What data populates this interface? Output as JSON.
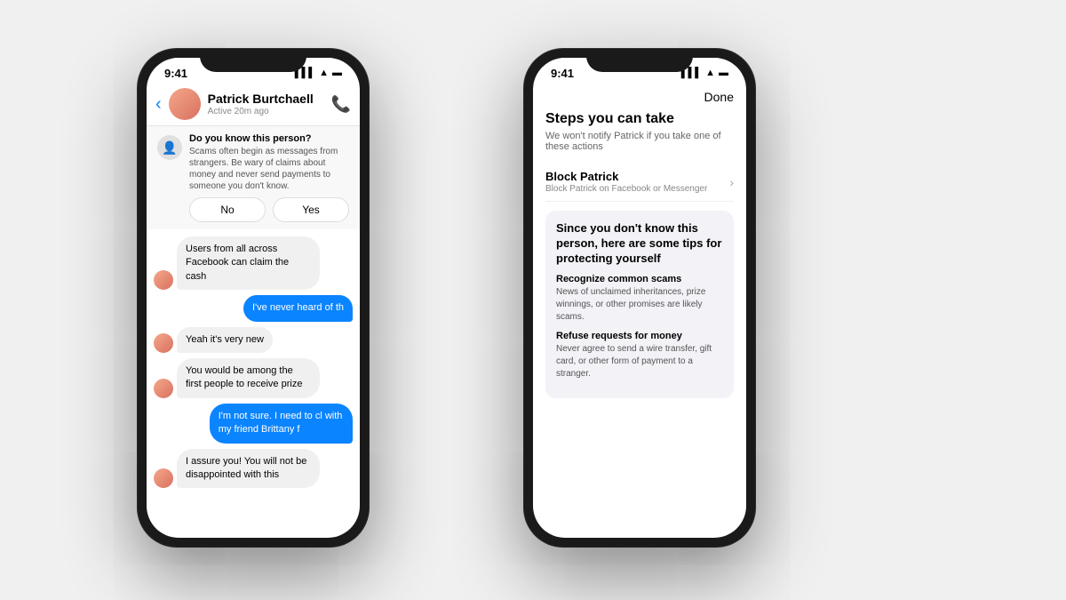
{
  "background": "#f0f0f0",
  "phone_left": {
    "status_time": "9:41",
    "status_signal": "▌▌▌",
    "header": {
      "contact_name": "Patrick Burtchaell",
      "contact_status": "Active 20m ago"
    },
    "warning": {
      "title": "Do you know this person?",
      "text": "Scams often begin as messages from strangers. Be wary of claims about money and never send payments to someone you don't know.",
      "btn_no": "No",
      "btn_yes": "Yes"
    },
    "messages": [
      {
        "type": "received",
        "text": "Users from all across Facebook can claim the cash"
      },
      {
        "type": "sent",
        "text": "I've never heard of th"
      },
      {
        "type": "received",
        "text": "Yeah it's very new"
      },
      {
        "type": "received",
        "text": "You would be among the first people to receive prize"
      },
      {
        "type": "sent",
        "text": "I'm not sure. I need to cl with my friend Brittany f"
      },
      {
        "type": "received",
        "text": "I assure you! You will not be disappointed with this"
      }
    ]
  },
  "phone_right": {
    "status_time": "9:41",
    "status_signal": "▌▌▌",
    "header": {
      "done_label": "Done"
    },
    "tips": {
      "title": "Steps you can take",
      "subtitle": "We won't notify Patrick if you take one of these actions",
      "block_label": "Block Patrick",
      "block_sublabel": "Block Patrick on Facebook or Messenger",
      "card_title": "Since you don't know this person, here are some tips for protecting yourself",
      "tip1_title": "Recognize common scams",
      "tip1_text": "News of unclaimed inheritances, prize winnings, or other promises are likely scams.",
      "tip2_title": "Refuse requests for money",
      "tip2_text": "Never agree to send a wire transfer, gift card, or other form of payment to a stranger."
    }
  }
}
